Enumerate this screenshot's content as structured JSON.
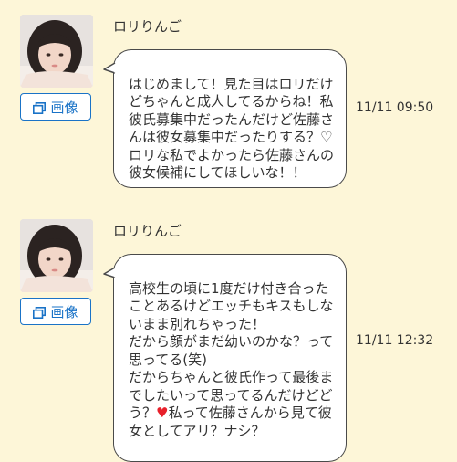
{
  "messages": [
    {
      "sender": "ロリりんご",
      "image_button_label": "画像",
      "text": "はじめまして！見た目はロリだけどちゃんと成人してるからね！私彼氏募集中だったんだけど佐藤さんは彼女募集中だったりする？♡ロリな私でよかったら佐藤さんの彼女候補にしてほしいな！！",
      "timestamp": "11/11 09:50"
    },
    {
      "sender": "ロリりんご",
      "image_button_label": "画像",
      "text_before_heart": "高校生の頃に1度だけ付き合ったことあるけどエッチもキスもしないまま別れちゃった！\nだから顔がまだ幼いのかな？って思ってる(笑)\nだからちゃんと彼氏作って最後までしたいって思ってるんだけどどう？",
      "heart": "♥",
      "text_after_heart": "私って佐藤さんから見て彼女としてアリ？ナシ？",
      "timestamp": "11/11 12:32"
    }
  ],
  "icons": {
    "image_button_icon": "image-icon",
    "heart_color": "#e8202b"
  }
}
